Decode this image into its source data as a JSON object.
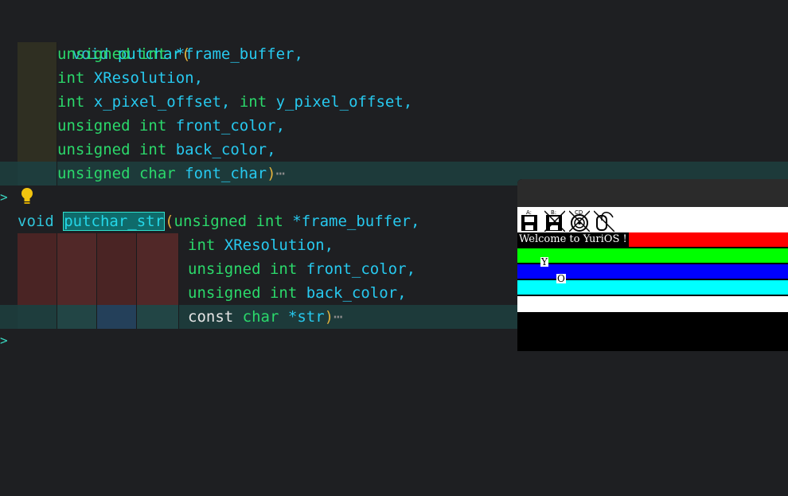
{
  "colors": {
    "background": "#1e1f22",
    "keyword": "#2fc4d9",
    "type": "#2bd96b",
    "param": "#27c9ef",
    "paren": "#e0b03c",
    "selection_border": "#2fe0cc",
    "vm_red": "#ff0000",
    "vm_green": "#00ff00",
    "vm_blue": "#0000ff",
    "vm_cyan": "#00ffff",
    "vm_white": "#ffffff"
  },
  "editor": {
    "putchar": {
      "void": "void",
      "name": "putchar",
      "open_paren": "(",
      "p1_type": "unsigned int",
      "p1_name": "*frame_buffer,",
      "p2_type": "int",
      "p2_name": "XResolution,",
      "p3_type1": "int",
      "p3_name1": "x_pixel_offset,",
      "p3_type2": "int",
      "p3_name2": "y_pixel_offset,",
      "p4_type": "unsigned int",
      "p4_name": "front_color,",
      "p5_type": "unsigned int",
      "p5_name": "back_color,",
      "p6_type": "unsigned char",
      "p6_name": "font_char",
      "close_paren": ")",
      "ellipsis": "⋯"
    },
    "putchar_str": {
      "void": "void",
      "name": "putchar_str",
      "open_paren": "(",
      "p1_type": "unsigned int",
      "p1_name": "*frame_buffer,",
      "p2_type": "int",
      "p2_name": "XResolution,",
      "p3_type": "unsigned int",
      "p3_name": "front_color,",
      "p4_type": "unsigned int",
      "p4_name": "back_color,",
      "p5_const": "const",
      "p5_type": "char",
      "p5_name": "*str",
      "close_paren": ")",
      "ellipsis": "⋯"
    },
    "fold_marker": ">",
    "lightbulb_icon": "lightbulb-icon"
  },
  "vm": {
    "toolbar_icons": [
      "floppy-a-icon",
      "floppy-b-icon",
      "cd-icon",
      "mouse-icon"
    ],
    "toolbar_labels": [
      "A:",
      "B:",
      "CD",
      ""
    ],
    "welcome_text": "Welcome to YuriOS !",
    "char_y": "Y",
    "char_o": "O"
  }
}
